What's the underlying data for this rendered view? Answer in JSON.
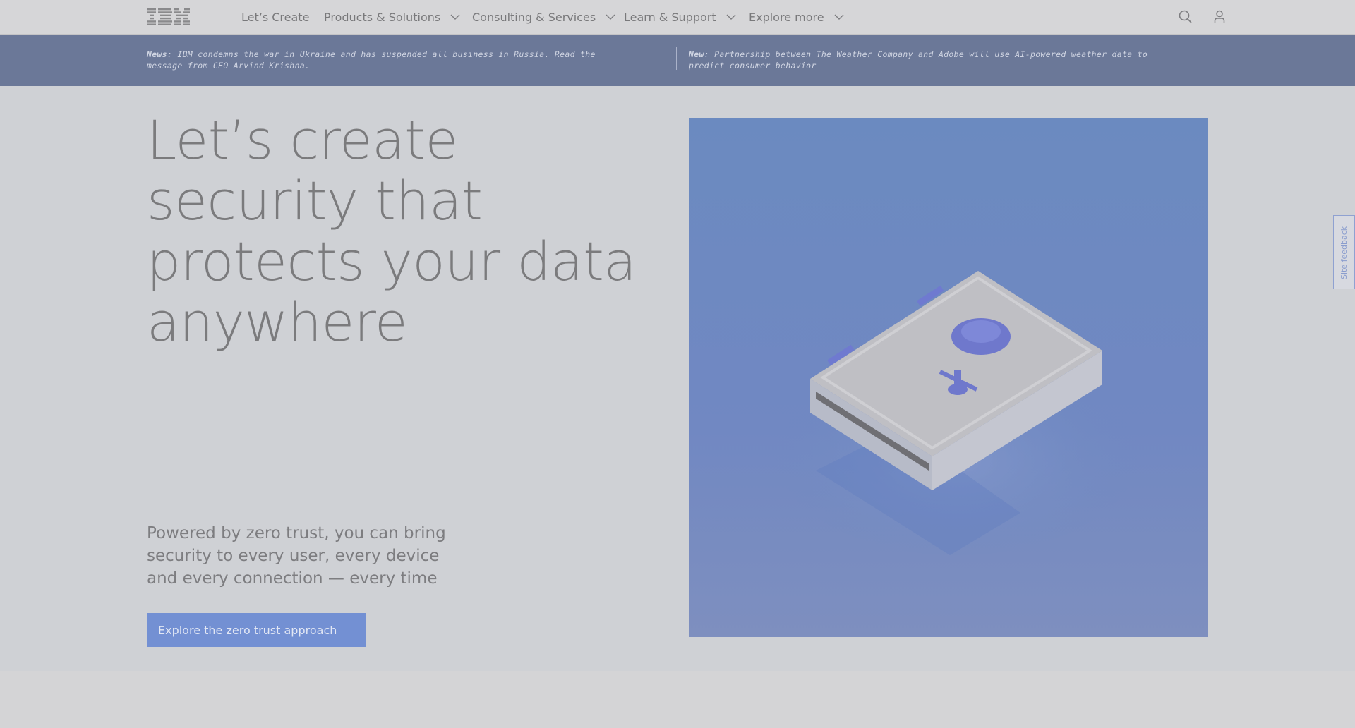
{
  "nav": {
    "logo_text": "IBM",
    "items": [
      {
        "label": "Let’s Create",
        "has_menu": false
      },
      {
        "label": "Products & Solutions",
        "has_menu": true
      },
      {
        "label": "Consulting & Services",
        "has_menu": true
      },
      {
        "label": "Learn & Support",
        "has_menu": true
      },
      {
        "label": "Explore more",
        "has_menu": true
      }
    ],
    "icons": [
      "search-icon",
      "user-icon"
    ]
  },
  "news": {
    "left": {
      "tag": "News",
      "text": ": IBM condemns the war in Ukraine and has suspended all business in Russia. Read the message from CEO Arvind Krishna."
    },
    "right": {
      "tag": "New",
      "text": ": Partnership between The Weather Company and Adobe will use AI-powered weather data to predict consumer behavior"
    }
  },
  "hero": {
    "headline": "Let’s create security that protects your data anywhere",
    "subtext": "Powered by zero trust, you can bring security to every user, every device and every connection — every time",
    "cta_label": "Explore the zero trust approach",
    "image_icon": "safe-illustration"
  },
  "feedback": {
    "label": "Site feedback"
  },
  "colors": {
    "accent": "#7390d3",
    "banner": "#6b7898",
    "hero_image_bg": "#6b8ac0"
  }
}
